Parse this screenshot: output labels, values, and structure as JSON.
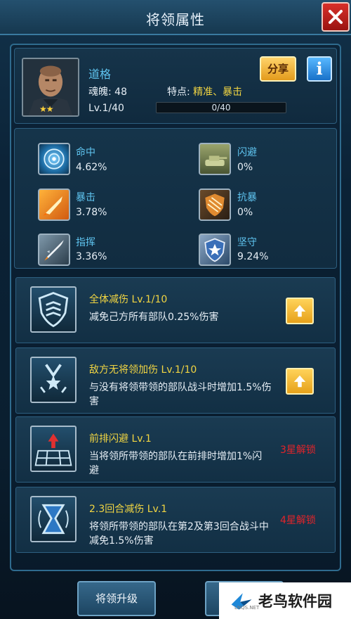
{
  "window": {
    "title": "将领属性"
  },
  "hero": {
    "name": "道格",
    "soul_label": "魂魄: 48",
    "trait_label": "特点: ",
    "trait_value": "精准、暴击",
    "level": "Lv.1/40",
    "xp_text": "0/40",
    "xp_progress": 0,
    "stars": "★★",
    "share_label": "分享",
    "info_label": "i"
  },
  "stats": [
    {
      "name": "命中",
      "value": "4.62%",
      "icon": "radar-icon"
    },
    {
      "name": "闪避",
      "value": "0%",
      "icon": "tank-icon"
    },
    {
      "name": "暴击",
      "value": "3.78%",
      "icon": "missile-icon"
    },
    {
      "name": "抗暴",
      "value": "0%",
      "icon": "shield-break-icon"
    },
    {
      "name": "指挥",
      "value": "3.36%",
      "icon": "rocket-icon"
    },
    {
      "name": "坚守",
      "value": "9.24%",
      "icon": "star-shield-icon"
    }
  ],
  "skills": [
    {
      "title": "全体减伤 Lv.1/10",
      "desc": "减免己方所有部队0.25%伤害",
      "action": "upgrade"
    },
    {
      "title": "敌方无将领加伤 Lv.1/10",
      "desc": "与没有将领带领的部队战斗时增加1.5%伤害",
      "action": "upgrade"
    },
    {
      "title": "前排闪避 Lv.1",
      "desc": "当将领所带领的部队在前排时增加1%闪避",
      "action": "locked",
      "unlock": "3星解锁"
    },
    {
      "title": "2.3回合减伤 Lv.1",
      "desc": "将领所带领的部队在第2及第3回合战斗中减免1.5%伤害",
      "action": "locked",
      "unlock": "4星解锁"
    }
  ],
  "bottom": {
    "upgrade_label": "将领升级"
  },
  "watermark": {
    "text": "老鸟软件园",
    "sub": "LNQS.NET"
  },
  "colors": {
    "accent_blue": "#5fc4f0",
    "gold": "#f1d542",
    "lock_red": "#e2242a"
  }
}
